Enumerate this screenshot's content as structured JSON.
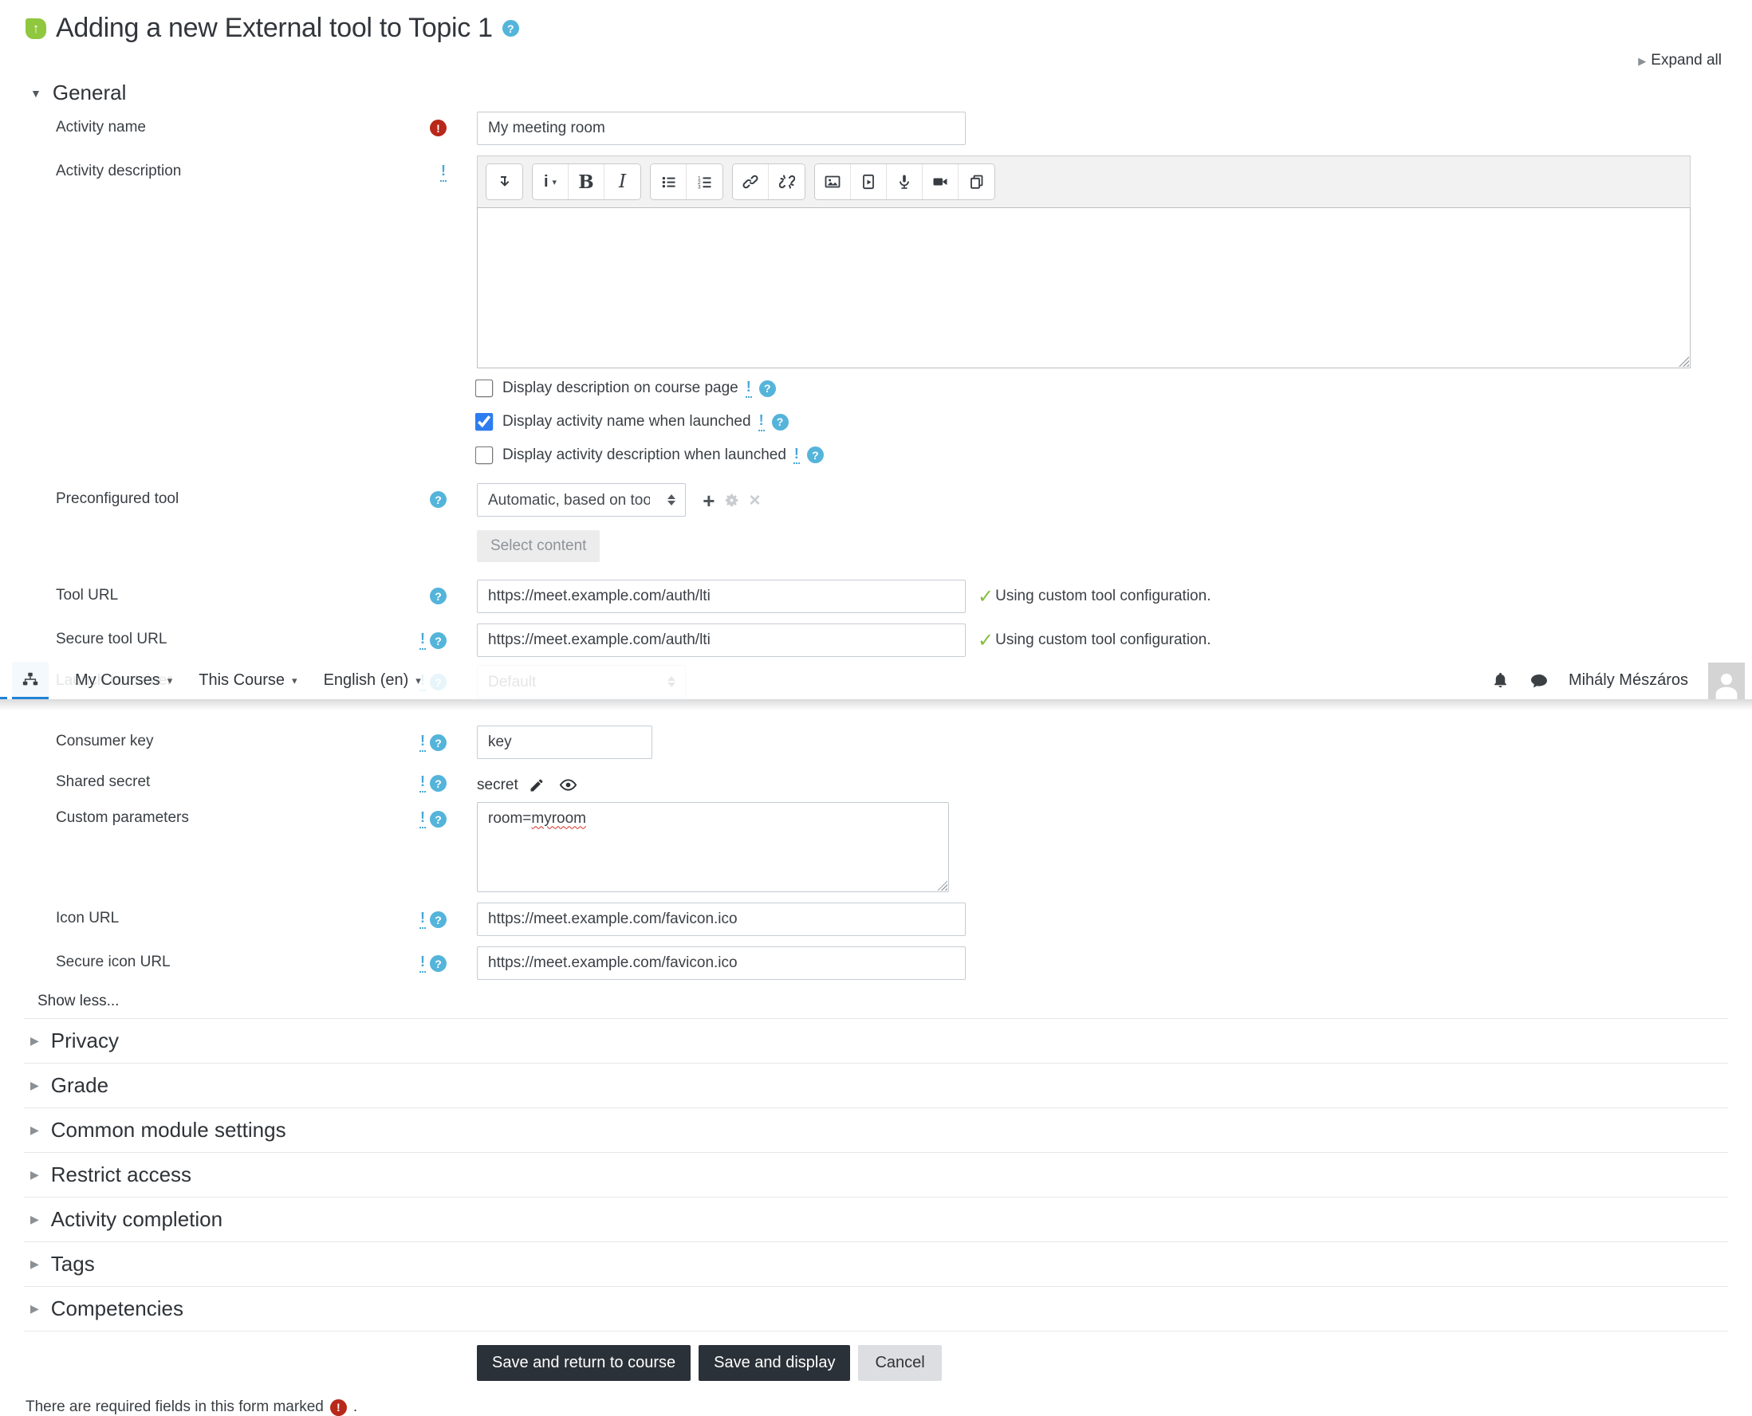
{
  "page": {
    "title": "Adding a new External tool to Topic 1",
    "expand_all": "Expand all",
    "show_less": "Show less...",
    "required_note": "There are required fields in this form marked",
    "required_note_suffix": "."
  },
  "navbar": {
    "menus": [
      {
        "label": "My Courses"
      },
      {
        "label": "This Course"
      },
      {
        "label": "English (en)"
      }
    ],
    "user_name": "Mihály Mészáros",
    "icons": [
      "sitemap-icon",
      "bell-icon",
      "chat-icon",
      "avatar"
    ]
  },
  "general": {
    "label": "General",
    "activity_name": {
      "label": "Activity name",
      "value": "My meeting room"
    },
    "activity_description": {
      "label": "Activity description",
      "toolbar_icons": [
        "collapse-toolbar",
        "paragraph-styles",
        "bold",
        "italic",
        "unordered-list",
        "ordered-list",
        "link",
        "unlink",
        "insert-image",
        "insert-media",
        "record-audio",
        "record-video",
        "manage-files"
      ]
    },
    "checkboxes": [
      {
        "label": "Display description on course page",
        "checked": false
      },
      {
        "label": "Display activity name when launched",
        "checked": true
      },
      {
        "label": "Display activity description when launched",
        "checked": false
      }
    ],
    "preconfigured_tool": {
      "label": "Preconfigured tool",
      "value": "Automatic, based on tool URL",
      "select_content": "Select content"
    },
    "tool_url": {
      "label": "Tool URL",
      "value": "https://meet.example.com/auth/lti",
      "status": "Using custom tool configuration."
    },
    "secure_tool_url": {
      "label": "Secure tool URL",
      "value": "https://meet.example.com/auth/lti",
      "status": "Using custom tool configuration."
    },
    "launch_container": {
      "label": "Launch container",
      "value": "Default"
    },
    "consumer_key": {
      "label": "Consumer key",
      "value": "key"
    },
    "shared_secret": {
      "label": "Shared secret",
      "value": "secret"
    },
    "custom_parameters": {
      "label": "Custom parameters",
      "value_prefix": "room=",
      "value_word": "myroom"
    },
    "icon_url": {
      "label": "Icon URL",
      "value": "https://meet.example.com/favicon.ico"
    },
    "secure_icon_url": {
      "label": "Secure icon URL",
      "value": "https://meet.example.com/favicon.ico"
    }
  },
  "sections": [
    {
      "label": "Privacy"
    },
    {
      "label": "Grade"
    },
    {
      "label": "Common module settings"
    },
    {
      "label": "Restrict access"
    },
    {
      "label": "Activity completion"
    },
    {
      "label": "Tags"
    },
    {
      "label": "Competencies"
    }
  ],
  "buttons": {
    "save_return": "Save and return to course",
    "save_display": "Save and display",
    "cancel": "Cancel"
  },
  "colors": {
    "accent_blue": "#2083d5",
    "help_blue": "#54b4da",
    "warn_blue": "#47a8d6",
    "required_red": "#b8281a",
    "success_green": "#84bf3f",
    "tool_icon_green": "#8fc73e",
    "primary_button": "#2b3138",
    "checkbox_blue": "#2d7cf0"
  }
}
